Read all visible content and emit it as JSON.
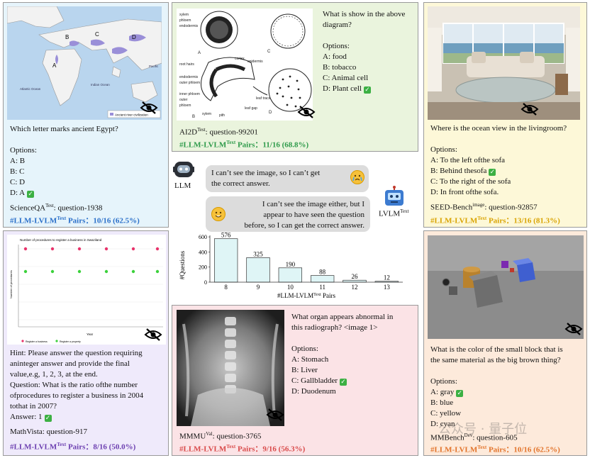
{
  "scienceqa": {
    "question": "Which letter marks ancient Egypt?",
    "options_label": "Options:",
    "options": [
      "A: B",
      "B: C",
      "C: D",
      "D: A"
    ],
    "source_name": "ScienceQA",
    "source_sup": "Test",
    "source_id": ": question-1938",
    "stat_prefix": "#LLM-LVLM",
    "stat_sup": "Text",
    "stat_suffix": " Pairs：10/16 (62.5%)",
    "map_labels": [
      "A",
      "B",
      "C",
      "D"
    ],
    "map_ocean_atlantic": "Atlantic Ocean",
    "map_ocean_indian": "Indian Ocean",
    "map_ocean_pacific": "Pacific Ocean",
    "map_legend": "Ancient river civilization",
    "color": "#2a6fc9"
  },
  "ai2d": {
    "question": [
      "What is show in the above",
      "diagram?"
    ],
    "options_label": "Options:",
    "options": [
      "A: food",
      "B: tobacco",
      "C: Animal cell",
      "D: Plant cell"
    ],
    "source_name": "AI2D",
    "source_sup": "Test",
    "source_id": ": question-99201",
    "stat_prefix": "#LLM-LVLM",
    "stat_sup": "Text",
    "stat_suffix": " Pairs：11/16 (68.8%)",
    "diagram_labels": [
      "xylem",
      "phloem",
      "endodermis",
      "cortex",
      "epidermis",
      "root hairs",
      "endodermis",
      "outer phloem",
      "inner phloem",
      "outer",
      "phloem",
      "xylem",
      "pith",
      "leaf trace",
      "leaf gap",
      "A",
      "B",
      "C",
      "D"
    ],
    "color": "#2e9a4a"
  },
  "seed": {
    "question": "Where is the ocean view in the livingroom?",
    "options_label": "Options:",
    "options": [
      "A: To the left ofthe sofa",
      "B: Behind thesofa",
      "C: To the right of the sofa",
      "D: In front ofthe sofa."
    ],
    "source_name": "SEED-Bench",
    "source_sup": "image",
    "source_id": ": question-92857",
    "stat_prefix": "#LLM-LVLM",
    "stat_sup": "Text",
    "stat_suffix": " Pairs：13/16 (81.3%)",
    "color": "#d9a300"
  },
  "chat": {
    "llm_label": "LLM",
    "lvlm_label": "LVLM",
    "lvlm_sup": "Text",
    "llm_msg": [
      "I can’t see the image, so I can’t get",
      "the correct answer."
    ],
    "lvlm_msg": [
      "I can’t see the image either, but I",
      "appear to have seen the question",
      "before, so I can get the correct answer."
    ]
  },
  "chart_data": {
    "type": "bar",
    "categories": [
      "8",
      "9",
      "10",
      "11",
      "12",
      "13"
    ],
    "values": [
      576,
      325,
      190,
      88,
      26,
      12
    ],
    "title": "",
    "xlabel": "#LLM-LVLM",
    "xlabel_sup": "Text",
    "xlabel_suffix": " Pairs",
    "ylabel": "#Questions",
    "ylim": [
      0,
      620
    ],
    "grid": false,
    "bar_color": "#dff5f6"
  },
  "mathvista": {
    "lines": [
      "Hint: Please answer the question requiring",
      "aninteger answer and provide the final",
      "value,e.g, 1, 2, 3, at the end.",
      "Question: What is the ratio ofthe number",
      "ofprocedures to register a business in 2004",
      "tothat in 2007?",
      "Answer: 1"
    ],
    "source_name": "MathVista",
    "source_id": ": question-917",
    "stat_prefix": "#LLM-LVLM",
    "stat_sup": "Text",
    "stat_suffix": " Pairs：8/16 (50.0%)",
    "plot_title": "Number of procedures to register a business in Swaziland",
    "plot_ylabel": "Number of procedures",
    "plot_xlabel": "Year",
    "plot_legend": [
      "Register a business",
      "Register a property"
    ],
    "color": "#6c3fb0"
  },
  "mmmu": {
    "question": [
      "What organ appears abnormal in",
      "this radiograph? <image 1>"
    ],
    "options_label": "Options:",
    "options": [
      "A: Stomach",
      "B: Liver",
      "C: Gallbladder",
      "D: Duodenum"
    ],
    "source_name": "MMMU",
    "source_sup": "Val",
    "source_id": ": question-3765",
    "stat_prefix": "#LLM-LVLM",
    "stat_sup": "Text",
    "stat_suffix": " Pairs：9/16 (56.3%)",
    "color": "#d94a4a"
  },
  "mmbench": {
    "question": [
      "What is the color of the small block that is",
      "the same material as the big brown thing?"
    ],
    "options_label": "Options:",
    "options": [
      "A: gray",
      "B: blue",
      "C: yellow",
      "D: cyan"
    ],
    "source_name": "MMBench",
    "source_sup": "Dev",
    "source_id": ": question-605",
    "stat_prefix": "#LLM-LVLM",
    "stat_sup": "Text",
    "stat_suffix": " Pairs：10/16 (62.5%)",
    "color": "#e2732a"
  },
  "watermark": "公众号 · 量子位"
}
